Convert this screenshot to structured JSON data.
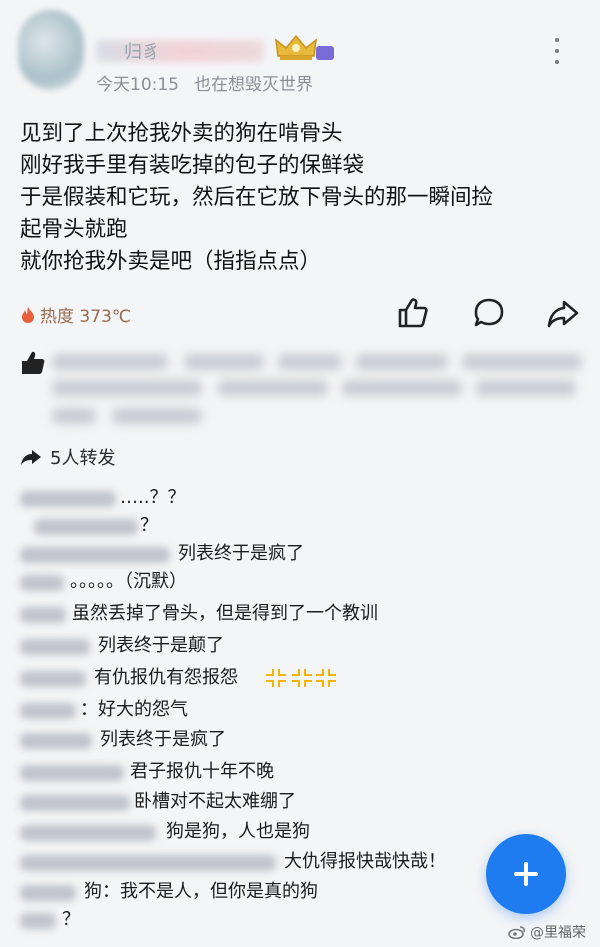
{
  "header": {
    "name_fragment": "归豸",
    "time": "今天10:15",
    "subtitle": "也在想毁灭世界",
    "more_icon": "more-dots-icon"
  },
  "post": {
    "lines": [
      "见到了上次抢我外卖的狗在啃骨头",
      "刚好我手里有装吃掉的包子的保鲜袋",
      "于是假装和它玩，然后在它放下骨头的那一瞬间捡",
      "起骨头就跑",
      "就你抢我外卖是吧（指指点点）"
    ]
  },
  "stats": {
    "heat_label": "热度 373℃",
    "heat_icon": "flame-icon",
    "actions": [
      "thumbs-up-icon",
      "comment-bubble-icon",
      "share-arrow-icon"
    ]
  },
  "reposts": {
    "label": "5人转发",
    "icon": "repost-arrow-icon"
  },
  "comments": [
    {
      "text": "…..？？"
    },
    {
      "text": "？"
    },
    {
      "text": "列表终于是疯了"
    },
    {
      "text": "。。。。。（沉默）"
    },
    {
      "text": "虽然丢掉了骨头，但是得到了一个教训"
    },
    {
      "text": "列表终于是颠了"
    },
    {
      "text": "有仇报仇有怨报怨"
    },
    {
      "text": "：好大的怨气"
    },
    {
      "text": "列表终于是疯了"
    },
    {
      "text": "君子报仇十年不晚"
    },
    {
      "text": "卧槽对不起太难绷了"
    },
    {
      "text": "狗是狗，人也是狗"
    },
    {
      "text": "大仇得报快哉快哉！"
    },
    {
      "text": "狗：我不是人，但你是真的狗"
    },
    {
      "text": "？"
    }
  ],
  "fab": {
    "icon": "plus-icon"
  },
  "watermark": {
    "text": "@里福荣"
  },
  "colors": {
    "accent": "#1f7cf0",
    "heat": "#e8603c",
    "anger": "#f5b400"
  }
}
